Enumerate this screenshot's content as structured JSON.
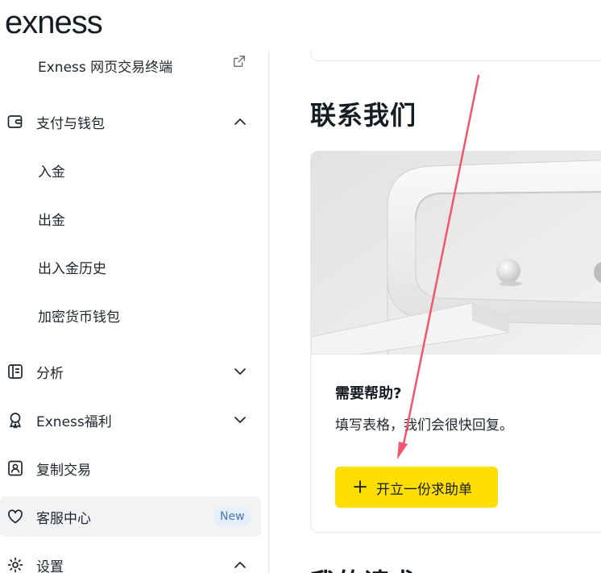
{
  "brand": {
    "logo": "exness"
  },
  "sidebar": {
    "items": [
      {
        "label": "Exness 网页交易终端",
        "icon": "external-link-icon",
        "type": "sub"
      },
      {
        "label": "支付与钱包",
        "icon": "wallet-icon",
        "chevron": "chevron-up"
      },
      {
        "label": "入金",
        "type": "sub"
      },
      {
        "label": "出金",
        "type": "sub"
      },
      {
        "label": "出入金历史",
        "type": "sub"
      },
      {
        "label": "加密货币钱包",
        "type": "sub"
      },
      {
        "label": "分析",
        "icon": "analytics-icon",
        "chevron": "chevron-down"
      },
      {
        "label": "Exness福利",
        "icon": "award-icon",
        "chevron": "chevron-down"
      },
      {
        "label": "复制交易",
        "icon": "copy-trading-icon"
      },
      {
        "label": "客服中心",
        "icon": "heart-icon",
        "badge": "New",
        "active": true
      },
      {
        "label": "设置",
        "icon": "gear-icon",
        "chevron": "chevron-up"
      }
    ]
  },
  "main": {
    "section_title": "联系我们",
    "card": {
      "heading": "需要帮助?",
      "text": "填写表格，我们会很快回复。",
      "button_label": "开立一份求助单"
    },
    "next_section_title": "我的请求"
  },
  "colors": {
    "accent_button": "#ffde02",
    "badge_bg": "#e5eef9",
    "badge_text": "#4a78b4",
    "annotation_arrow": "#f0566e"
  }
}
